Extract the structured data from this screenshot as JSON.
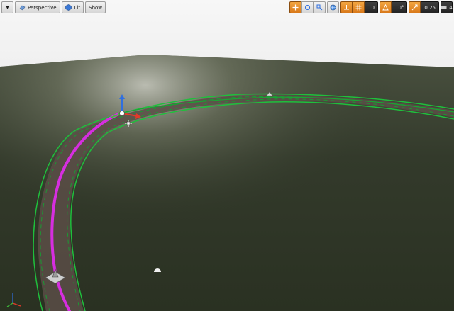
{
  "toolbar": {
    "left": {
      "viewport_menu_icon": "chevron-down-icon",
      "perspective_label": "Perspective",
      "lit_label": "Lit",
      "show_label": "Show"
    },
    "right": {
      "transform_icons": [
        "move-icon",
        "rotate-icon",
        "scale-icon",
        "world-local-icon"
      ],
      "grid_snap_value": "10",
      "rotation_snap_value": "10°",
      "scale_snap_value": "0.25",
      "camera_speed_value": "4"
    }
  },
  "colors": {
    "sky": "#ffffff",
    "horizon_haze": "#c9c9c9",
    "ground": "#2e3526",
    "spline_green": "#1fbf3c",
    "spline_magenta": "#d62ee0",
    "road": "#5e5048",
    "toolbar_orange": "#e88a24",
    "gizmo_x": "#e23a2a",
    "gizmo_y": "#3fbf3a",
    "gizmo_z": "#2f6fe0"
  }
}
